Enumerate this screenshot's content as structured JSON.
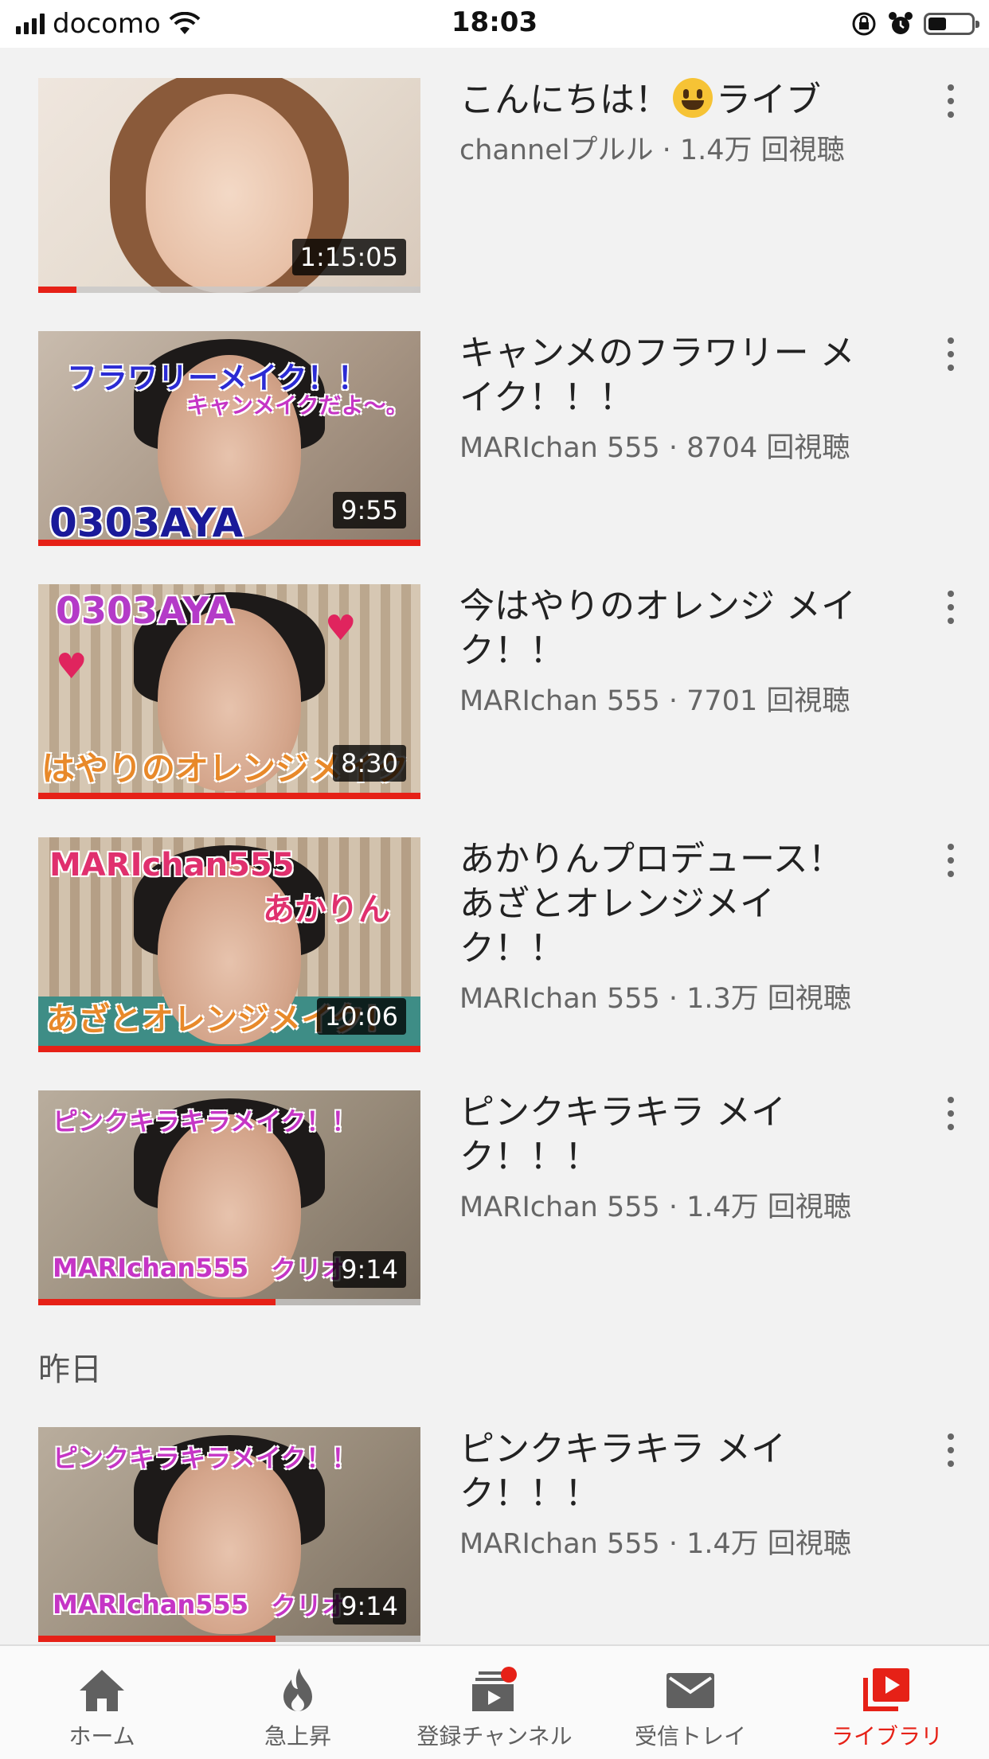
{
  "status_bar": {
    "carrier": "docomo",
    "time": "18:03"
  },
  "videos": [
    {
      "title": "こんにちは！",
      "title_suffix": "ライブ",
      "emoji": "smiley-face",
      "channel": "channelプルル",
      "views": "1.4万 回視聴",
      "meta": "channelプルル · 1.4万 回視聴",
      "duration": "1:15:05",
      "watched_fraction": 0.1,
      "thumb_text": []
    },
    {
      "title": "キャンメのフラワリー メイク！！！",
      "meta": "MARIchan 555 · 8704 回視聴",
      "duration": "9:55",
      "watched_fraction": 1.0,
      "thumb_text": [
        "フラワリーメイク！！",
        "キャンメイクだよ〜。",
        "0303AYA"
      ]
    },
    {
      "title": "今はやりのオレンジ メイク！！",
      "meta": "MARIchan 555 · 7701 回視聴",
      "duration": "8:30",
      "watched_fraction": 1.0,
      "thumb_text": [
        "0303AYA",
        "はやりのオレンジメイク"
      ]
    },
    {
      "title": "あかりんプロデュース！ あざとオレンジメイ ク！！",
      "meta": "MARIchan 555 · 1.3万 回視聴",
      "duration": "10:06",
      "watched_fraction": 1.0,
      "thumb_text": [
        "MARIchan555",
        "あかりん",
        "あざとオレンジメイク！"
      ]
    },
    {
      "title": "ピンクキラキラ メイク！！！",
      "meta": "MARIchan 555 · 1.4万 回視聴",
      "duration": "9:14",
      "watched_fraction": 0.62,
      "thumb_text": [
        "ピンクキラキラメイク！！",
        "MARIchan555",
        "クリオ"
      ]
    }
  ],
  "section_label": "昨日",
  "yesterday_videos": [
    {
      "title": "ピンクキラキラ メイク！！！",
      "meta": "MARIchan 555 · 1.4万 回視聴",
      "duration": "9:14",
      "watched_fraction": 0.62,
      "thumb_text": [
        "ピンクキラキラメイク！！",
        "MARIchan555",
        "クリオ"
      ]
    }
  ],
  "tabs": [
    {
      "label": "ホーム",
      "icon": "home-icon"
    },
    {
      "label": "急上昇",
      "icon": "flame-icon"
    },
    {
      "label": "登録チャンネル",
      "icon": "subscriptions-icon"
    },
    {
      "label": "受信トレイ",
      "icon": "inbox-icon"
    },
    {
      "label": "ライブラリ",
      "icon": "library-icon",
      "active": true
    }
  ],
  "colors": {
    "accent": "#e62117",
    "background": "#f2f2f2",
    "text_secondary": "#666666"
  }
}
